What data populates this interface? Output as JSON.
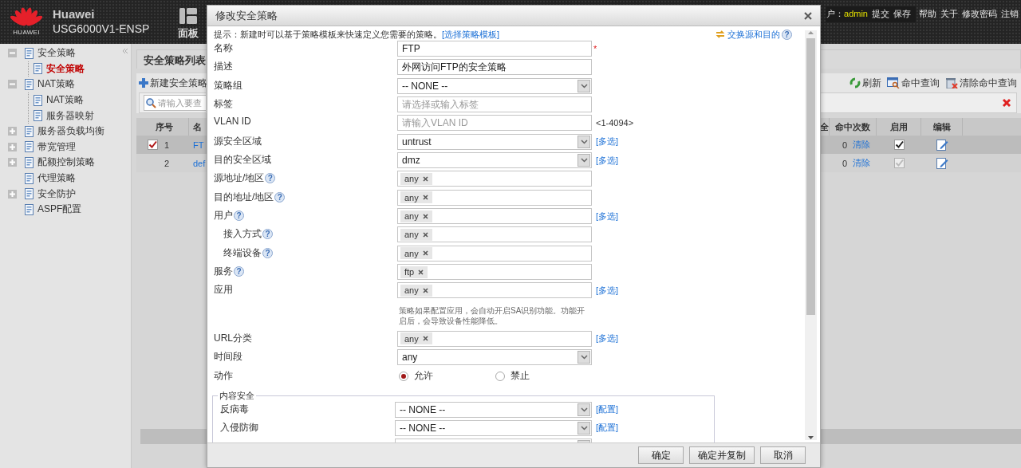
{
  "header": {
    "logo_text": "HUAWEI",
    "brand": "Huawei",
    "model": "USG6000V1-ENSP",
    "dashboard": "面板",
    "user_label": "户：",
    "user": "admin",
    "session_actions": [
      "提交",
      "保存"
    ],
    "links": [
      "帮助",
      "关于",
      "修改密码",
      "注销"
    ]
  },
  "sidebar": {
    "items": [
      {
        "kind": "group",
        "label": "安全策略",
        "expanded": true,
        "selected": false,
        "children": [
          {
            "label": "安全策略",
            "selected": true
          }
        ]
      },
      {
        "kind": "group",
        "label": "NAT策略",
        "expanded": true,
        "selected": false,
        "children": [
          {
            "label": "NAT策略",
            "selected": false
          },
          {
            "label": "服务器映射",
            "selected": false
          }
        ]
      },
      {
        "kind": "group",
        "label": "服务器负载均衡",
        "expanded": false,
        "selected": false
      },
      {
        "kind": "group",
        "label": "带宽管理",
        "expanded": false,
        "selected": false
      },
      {
        "kind": "group",
        "label": "配额控制策略",
        "expanded": false,
        "selected": false
      },
      {
        "kind": "leaf",
        "label": "代理策略",
        "selected": false
      },
      {
        "kind": "group",
        "label": "安全防护",
        "expanded": false,
        "selected": false
      },
      {
        "kind": "leaf",
        "label": "ASPF配置",
        "selected": false
      }
    ]
  },
  "policy_list": {
    "title": "安全策略列表",
    "new_button": "新建安全策略",
    "search_placeholder": "请输入要查",
    "toolbar": [
      {
        "kind": "refresh",
        "label": "刷新"
      },
      {
        "kind": "query",
        "label": "命中查询"
      },
      {
        "kind": "clear",
        "label": "清除命中查询"
      }
    ],
    "columns_left": [
      "序号",
      "名"
    ],
    "columns_right": [
      "全",
      "命中次数",
      "启用",
      "编辑"
    ],
    "rows": [
      {
        "selected": true,
        "checked": true,
        "index": "1",
        "name": "FT",
        "hits": "0",
        "clear": "清除",
        "enabled": true,
        "disabled": false
      },
      {
        "selected": false,
        "checked": false,
        "index": "2",
        "name": "def",
        "hits": "0",
        "clear": "清除",
        "enabled": true,
        "disabled": true
      }
    ]
  },
  "dialog": {
    "title": "修改安全策略",
    "hint": "提示：新建时可以基于策略模板来快速定义您需要的策略。",
    "hint_link": "[选择策略模板]",
    "swap_link": "交换源和目的",
    "swap_help": "?",
    "fields": [
      {
        "kind": "text",
        "label": "名称",
        "value": "FTP",
        "required_mark": "*"
      },
      {
        "kind": "text",
        "label": "描述",
        "value": "外网访问FTP的安全策略"
      },
      {
        "kind": "select",
        "label": "策略组",
        "value": "-- NONE --"
      },
      {
        "kind": "text",
        "label": "标签",
        "placeholder": "请选择或输入标签"
      },
      {
        "kind": "text",
        "label": "VLAN ID",
        "placeholder": "请输入VLAN ID",
        "suffix": "<1-4094>"
      },
      {
        "kind": "select",
        "label": "源安全区域",
        "value": "untrust",
        "link": "[多选]"
      },
      {
        "kind": "select",
        "label": "目的安全区域",
        "value": "dmz",
        "link": "[多选]"
      },
      {
        "kind": "tags",
        "label": "源地址/地区",
        "help": "?",
        "tags": [
          "any"
        ]
      },
      {
        "kind": "tags",
        "label": "目的地址/地区",
        "help": "?",
        "tags": [
          "any"
        ]
      },
      {
        "kind": "tags",
        "label": "用户",
        "help": "?",
        "tags": [
          "any"
        ],
        "link": "[多选]",
        "children": [
          {
            "kind": "tags",
            "label": "接入方式",
            "help": "?",
            "tags": [
              "any"
            ]
          },
          {
            "kind": "tags",
            "label": "终端设备",
            "help": "?",
            "tags": [
              "any"
            ]
          }
        ]
      },
      {
        "kind": "tags",
        "label": "服务",
        "help": "?",
        "tags": [
          "ftp"
        ]
      },
      {
        "kind": "tags",
        "label": "应用",
        "tags": [
          "any"
        ],
        "link": "[多选]",
        "note": "策略如果配置应用，会自动开启SA识别功能。功能开启后，会导致设备性能降低。"
      },
      {
        "kind": "tags",
        "label": "URL分类",
        "tags": [
          "any"
        ],
        "link": "[多选]"
      },
      {
        "kind": "select",
        "label": "时间段",
        "value": "any"
      },
      {
        "kind": "radio",
        "label": "动作",
        "options": [
          {
            "label": "允许",
            "selected": true
          },
          {
            "label": "禁止",
            "selected": false
          }
        ]
      }
    ],
    "content_security": {
      "legend": "内容安全",
      "fields": [
        {
          "kind": "select",
          "label": "反病毒",
          "value": "-- NONE --",
          "link": "[配置]"
        },
        {
          "kind": "select",
          "label": "入侵防御",
          "value": "-- NONE --",
          "link": "[配置]"
        },
        {
          "kind": "select"
        }
      ]
    },
    "buttons": [
      "确定",
      "确定并复制",
      "取消"
    ]
  }
}
